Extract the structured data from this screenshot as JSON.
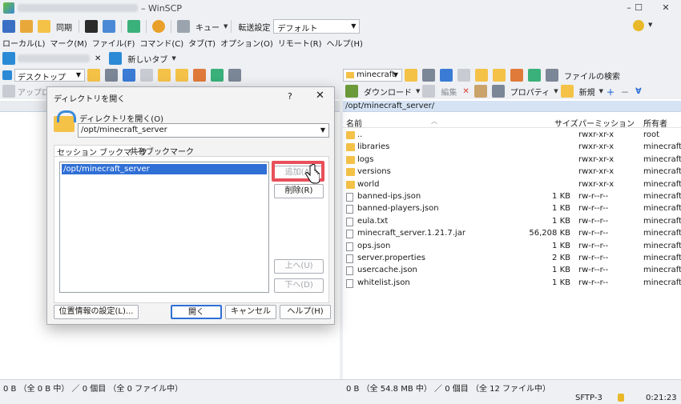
{
  "window": {
    "title": "– WinSCP",
    "minimize": "–",
    "maximize": "☐",
    "close": "✕"
  },
  "toolbar1": {
    "sync": "同期",
    "queue": "キュー",
    "transfer_label": "転送設定",
    "transfer_value": "デフォルト"
  },
  "menu": [
    "ローカル(L)",
    "マーク(M)",
    "ファイル(F)",
    "コマンド(C)",
    "タブ(T)",
    "オプション(O)",
    "リモート(R)",
    "ヘルプ(H)"
  ],
  "session": {
    "close": "✕",
    "new_tab": "新しいタブ"
  },
  "left": {
    "drive": "デスクトップ",
    "upload": "アップロ"
  },
  "right": {
    "folder": "minecraft",
    "find": "ファイルの検索",
    "download": "ダウンロード",
    "edit": "編集",
    "properties": "プロパティ",
    "new": "新規",
    "path": "/opt/minecraft_server/",
    "headers": {
      "name": "名前",
      "size": "サイズ",
      "perm": "パーミッション",
      "owner": "所有者"
    },
    "files": [
      {
        "name": "..",
        "size": "",
        "perm": "rwxr-xr-x",
        "owner": "root",
        "type": "up"
      },
      {
        "name": "libraries",
        "size": "",
        "perm": "rwxr-xr-x",
        "owner": "minecraft",
        "type": "folder"
      },
      {
        "name": "logs",
        "size": "",
        "perm": "rwxr-xr-x",
        "owner": "minecraft",
        "type": "folder"
      },
      {
        "name": "versions",
        "size": "",
        "perm": "rwxr-xr-x",
        "owner": "minecraft",
        "type": "folder"
      },
      {
        "name": "world",
        "size": "",
        "perm": "rwxr-xr-x",
        "owner": "minecraft",
        "type": "folder"
      },
      {
        "name": "banned-ips.json",
        "size": "1 KB",
        "perm": "rw-r--r--",
        "owner": "minecraft",
        "type": "doc"
      },
      {
        "name": "banned-players.json",
        "size": "1 KB",
        "perm": "rw-r--r--",
        "owner": "minecraft",
        "type": "doc"
      },
      {
        "name": "eula.txt",
        "size": "1 KB",
        "perm": "rw-r--r--",
        "owner": "minecraft",
        "type": "doc"
      },
      {
        "name": "minecraft_server.1.21.7.jar",
        "size": "56,208 KB",
        "perm": "rw-r--r--",
        "owner": "minecraft",
        "type": "doc"
      },
      {
        "name": "ops.json",
        "size": "1 KB",
        "perm": "rw-r--r--",
        "owner": "minecraft",
        "type": "doc"
      },
      {
        "name": "server.properties",
        "size": "2 KB",
        "perm": "rw-r--r--",
        "owner": "minecraft",
        "type": "doc"
      },
      {
        "name": "usercache.json",
        "size": "1 KB",
        "perm": "rw-r--r--",
        "owner": "minecraft",
        "type": "doc"
      },
      {
        "name": "whitelist.json",
        "size": "1 KB",
        "perm": "rw-r--r--",
        "owner": "minecraft",
        "type": "doc"
      }
    ]
  },
  "status": {
    "left": "0 B （全 0 B 中）  ／ 0 個目 （全 0 ファイル中）",
    "right": "0 B （全 54.8 MB 中）  ／ 0 個目 （全 12 ファイル中）",
    "protocol": "SFTP-3",
    "time": "0:21:23"
  },
  "dialog": {
    "title": "ディレクトリを開く",
    "help_glyph": "?",
    "close_glyph": "✕",
    "label": "ディレクトリを開く(O)",
    "path": "/opt/minecraft_server",
    "tab_session": "セッション ブックマーク",
    "tab_shared": "共有ブックマーク",
    "bookmark": "/opt/minecraft_server",
    "add": "追加(A)",
    "remove": "削除(R)",
    "up": "上へ(U)",
    "down": "下へ(D)",
    "location": "位置情報の設定(L)...",
    "open": "開く",
    "cancel": "キャンセル",
    "help": "ヘルプ(H)"
  },
  "colors": {
    "highlight": "#e8505b",
    "selection": "#2f6fd6",
    "folder": "#f5c248"
  }
}
